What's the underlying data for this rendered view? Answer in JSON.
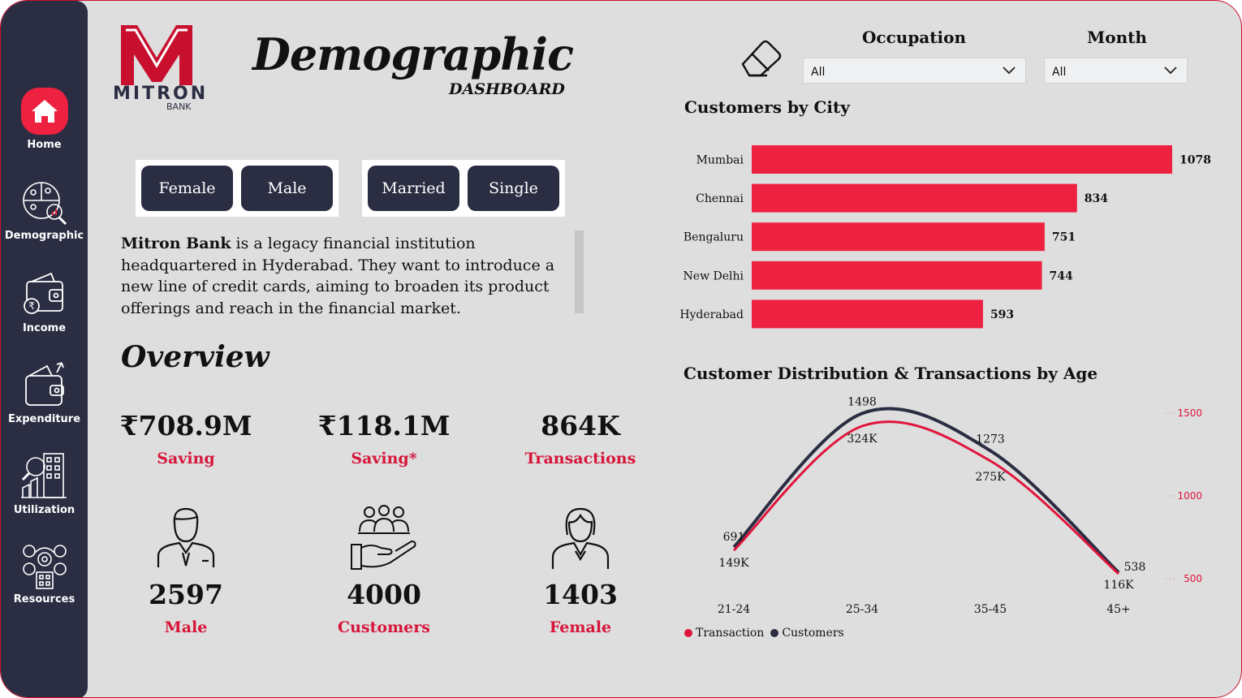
{
  "nav": [
    {
      "label": "Home",
      "icon": "home-icon",
      "active": true
    },
    {
      "label": "Demographic",
      "icon": "demographic-icon"
    },
    {
      "label": "Income",
      "icon": "wallet-icon"
    },
    {
      "label": "Expenditure",
      "icon": "expenditure-icon"
    },
    {
      "label": "Utilization",
      "icon": "utilization-icon"
    },
    {
      "label": "Resources",
      "icon": "resources-icon"
    }
  ],
  "logo": {
    "word": "MITRON",
    "sub": "BANK"
  },
  "header": {
    "title": "Demographic",
    "subtitle": "DASHBOARD"
  },
  "gender_filter": [
    "Female",
    "Male"
  ],
  "marital_filter": [
    "Married",
    "Single"
  ],
  "description": {
    "bold": "Mitron Bank",
    "rest": " is a legacy financial institution headquartered in Hyderabad. They want to introduce a new line of credit cards, aiming to broaden its product offerings and reach in the financial market."
  },
  "overview": {
    "title": "Overview",
    "kpis": [
      {
        "value": "₹708.9M",
        "label": "Saving"
      },
      {
        "value": "₹118.1M",
        "label": "Saving*"
      },
      {
        "value": "864K",
        "label": "Transactions"
      },
      {
        "value": "2597",
        "label": "Male",
        "icon": "male-person-icon"
      },
      {
        "value": "4000",
        "label": "Customers",
        "icon": "customers-hand-icon"
      },
      {
        "value": "1403",
        "label": "Female",
        "icon": "female-person-icon"
      }
    ]
  },
  "filters": {
    "occupation": {
      "label": "Occupation",
      "value": "All"
    },
    "month": {
      "label": "Month",
      "value": "All"
    }
  },
  "colors": {
    "accent": "#ee2240",
    "dark": "#2b2d42",
    "label_red": "#d6163a",
    "background": "#dedede"
  },
  "chart_data": [
    {
      "type": "bar",
      "title": "Customers by City",
      "orientation": "horizontal",
      "categories": [
        "Mumbai",
        "Chennai",
        "Bengaluru",
        "New Delhi",
        "Hyderabad"
      ],
      "values": [
        1078,
        834,
        751,
        744,
        593
      ],
      "color": "#ee2240"
    },
    {
      "type": "line",
      "title": "Customer Distribution & Transactions by Age",
      "categories": [
        "21-24",
        "25-34",
        "35-45",
        "45+"
      ],
      "series": [
        {
          "name": "Transaction",
          "values": [
            149,
            324,
            275,
            116
          ],
          "labels": [
            "149K",
            "324K",
            "275K",
            "116K"
          ],
          "color": "#e0153c"
        },
        {
          "name": "Customers",
          "values": [
            691,
            1498,
            1273,
            538
          ],
          "labels": [
            "691",
            "1498",
            "1273",
            "538"
          ],
          "color": "#2b2d42"
        }
      ],
      "y2_ticks": [
        "1500",
        "1000",
        "500"
      ],
      "legend": "bottom-left"
    }
  ]
}
